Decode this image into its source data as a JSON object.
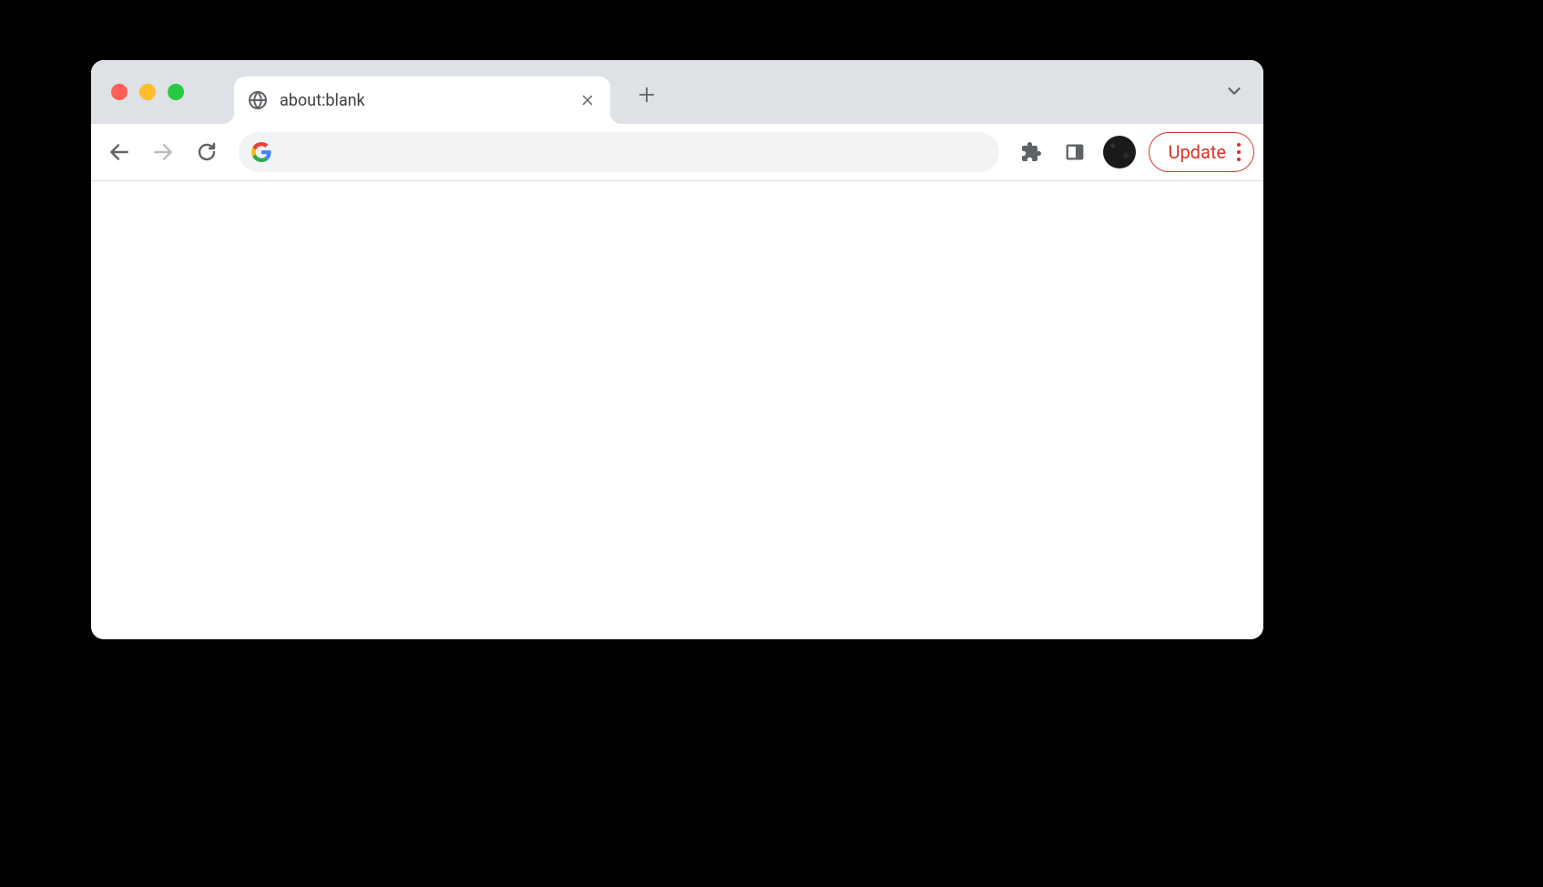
{
  "tab": {
    "title": "about:blank"
  },
  "address": {
    "value": "",
    "placeholder": ""
  },
  "update": {
    "label": "Update"
  },
  "colors": {
    "tab_bar_bg": "#dee1e6",
    "update_accent": "#d93025"
  }
}
